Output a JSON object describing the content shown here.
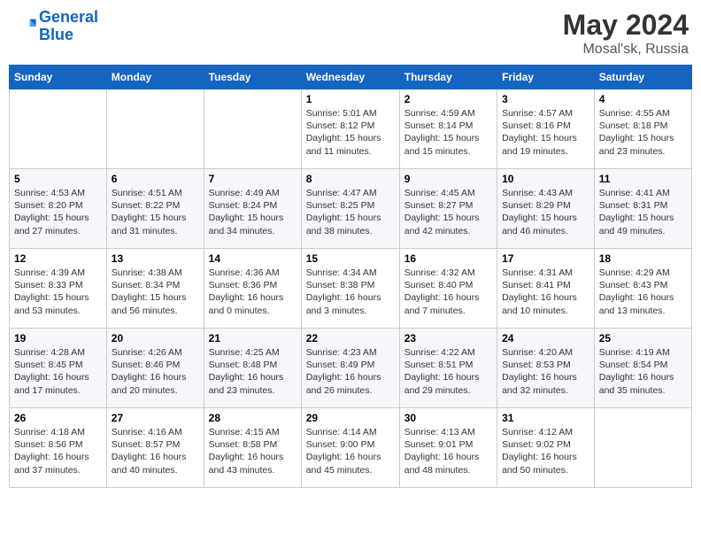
{
  "header": {
    "logo_line1": "General",
    "logo_line2": "Blue",
    "month": "May 2024",
    "location": "Mosal'sk, Russia"
  },
  "weekdays": [
    "Sunday",
    "Monday",
    "Tuesday",
    "Wednesday",
    "Thursday",
    "Friday",
    "Saturday"
  ],
  "weeks": [
    [
      {
        "day": "",
        "info": ""
      },
      {
        "day": "",
        "info": ""
      },
      {
        "day": "",
        "info": ""
      },
      {
        "day": "1",
        "info": "Sunrise: 5:01 AM\nSunset: 8:12 PM\nDaylight: 15 hours and 11 minutes."
      },
      {
        "day": "2",
        "info": "Sunrise: 4:59 AM\nSunset: 8:14 PM\nDaylight: 15 hours and 15 minutes."
      },
      {
        "day": "3",
        "info": "Sunrise: 4:57 AM\nSunset: 8:16 PM\nDaylight: 15 hours and 19 minutes."
      },
      {
        "day": "4",
        "info": "Sunrise: 4:55 AM\nSunset: 8:18 PM\nDaylight: 15 hours and 23 minutes."
      }
    ],
    [
      {
        "day": "5",
        "info": "Sunrise: 4:53 AM\nSunset: 8:20 PM\nDaylight: 15 hours and 27 minutes."
      },
      {
        "day": "6",
        "info": "Sunrise: 4:51 AM\nSunset: 8:22 PM\nDaylight: 15 hours and 31 minutes."
      },
      {
        "day": "7",
        "info": "Sunrise: 4:49 AM\nSunset: 8:24 PM\nDaylight: 15 hours and 34 minutes."
      },
      {
        "day": "8",
        "info": "Sunrise: 4:47 AM\nSunset: 8:25 PM\nDaylight: 15 hours and 38 minutes."
      },
      {
        "day": "9",
        "info": "Sunrise: 4:45 AM\nSunset: 8:27 PM\nDaylight: 15 hours and 42 minutes."
      },
      {
        "day": "10",
        "info": "Sunrise: 4:43 AM\nSunset: 8:29 PM\nDaylight: 15 hours and 46 minutes."
      },
      {
        "day": "11",
        "info": "Sunrise: 4:41 AM\nSunset: 8:31 PM\nDaylight: 15 hours and 49 minutes."
      }
    ],
    [
      {
        "day": "12",
        "info": "Sunrise: 4:39 AM\nSunset: 8:33 PM\nDaylight: 15 hours and 53 minutes."
      },
      {
        "day": "13",
        "info": "Sunrise: 4:38 AM\nSunset: 8:34 PM\nDaylight: 15 hours and 56 minutes."
      },
      {
        "day": "14",
        "info": "Sunrise: 4:36 AM\nSunset: 8:36 PM\nDaylight: 16 hours and 0 minutes."
      },
      {
        "day": "15",
        "info": "Sunrise: 4:34 AM\nSunset: 8:38 PM\nDaylight: 16 hours and 3 minutes."
      },
      {
        "day": "16",
        "info": "Sunrise: 4:32 AM\nSunset: 8:40 PM\nDaylight: 16 hours and 7 minutes."
      },
      {
        "day": "17",
        "info": "Sunrise: 4:31 AM\nSunset: 8:41 PM\nDaylight: 16 hours and 10 minutes."
      },
      {
        "day": "18",
        "info": "Sunrise: 4:29 AM\nSunset: 8:43 PM\nDaylight: 16 hours and 13 minutes."
      }
    ],
    [
      {
        "day": "19",
        "info": "Sunrise: 4:28 AM\nSunset: 8:45 PM\nDaylight: 16 hours and 17 minutes."
      },
      {
        "day": "20",
        "info": "Sunrise: 4:26 AM\nSunset: 8:46 PM\nDaylight: 16 hours and 20 minutes."
      },
      {
        "day": "21",
        "info": "Sunrise: 4:25 AM\nSunset: 8:48 PM\nDaylight: 16 hours and 23 minutes."
      },
      {
        "day": "22",
        "info": "Sunrise: 4:23 AM\nSunset: 8:49 PM\nDaylight: 16 hours and 26 minutes."
      },
      {
        "day": "23",
        "info": "Sunrise: 4:22 AM\nSunset: 8:51 PM\nDaylight: 16 hours and 29 minutes."
      },
      {
        "day": "24",
        "info": "Sunrise: 4:20 AM\nSunset: 8:53 PM\nDaylight: 16 hours and 32 minutes."
      },
      {
        "day": "25",
        "info": "Sunrise: 4:19 AM\nSunset: 8:54 PM\nDaylight: 16 hours and 35 minutes."
      }
    ],
    [
      {
        "day": "26",
        "info": "Sunrise: 4:18 AM\nSunset: 8:56 PM\nDaylight: 16 hours and 37 minutes."
      },
      {
        "day": "27",
        "info": "Sunrise: 4:16 AM\nSunset: 8:57 PM\nDaylight: 16 hours and 40 minutes."
      },
      {
        "day": "28",
        "info": "Sunrise: 4:15 AM\nSunset: 8:58 PM\nDaylight: 16 hours and 43 minutes."
      },
      {
        "day": "29",
        "info": "Sunrise: 4:14 AM\nSunset: 9:00 PM\nDaylight: 16 hours and 45 minutes."
      },
      {
        "day": "30",
        "info": "Sunrise: 4:13 AM\nSunset: 9:01 PM\nDaylight: 16 hours and 48 minutes."
      },
      {
        "day": "31",
        "info": "Sunrise: 4:12 AM\nSunset: 9:02 PM\nDaylight: 16 hours and 50 minutes."
      },
      {
        "day": "",
        "info": ""
      }
    ]
  ]
}
